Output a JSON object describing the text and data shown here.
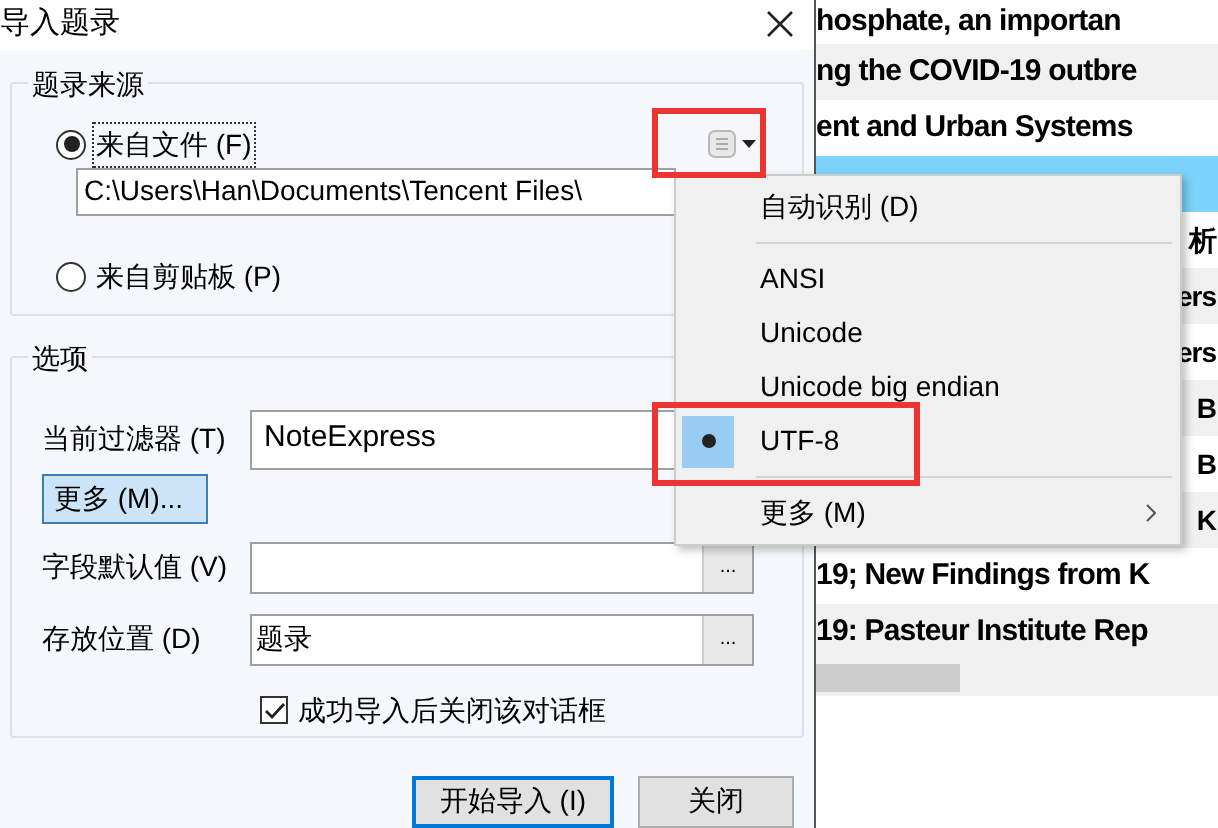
{
  "window": {
    "title": "导入题录"
  },
  "source_group": {
    "title": "题录来源",
    "options": [
      {
        "label": "来自文件 (F)",
        "selected": true,
        "path": "C:\\Users\\Han\\Documents\\Tencent Files\\"
      },
      {
        "label": "来自剪贴板 (P)",
        "selected": false
      }
    ]
  },
  "options_group": {
    "title": "选项",
    "filter": {
      "label": "当前过滤器 (T)",
      "value": "NoteExpress"
    },
    "more_button": "更多 (M)...",
    "default_value": {
      "label": "字段默认值 (V)",
      "button": "..."
    },
    "location": {
      "label": "存放位置 (D)",
      "value": "题录",
      "button": "..."
    },
    "close_after": {
      "label": "成功导入后关闭该对话框",
      "checked": true
    }
  },
  "buttons": [
    {
      "label": "开始导入 (I)",
      "default": true
    },
    {
      "label": "关闭",
      "default": false
    }
  ],
  "encoding_menu": [
    {
      "kind": "item",
      "label": "自动识别 (D)",
      "selected": false
    },
    {
      "kind": "separator"
    },
    {
      "kind": "item",
      "label": "ANSI",
      "selected": false
    },
    {
      "kind": "item",
      "label": "Unicode",
      "selected": false
    },
    {
      "kind": "item",
      "label": "Unicode big endian",
      "selected": false
    },
    {
      "kind": "item",
      "label": "UTF-8",
      "selected": true
    },
    {
      "kind": "separator"
    },
    {
      "kind": "submenu",
      "label": "更多 (M)"
    }
  ],
  "background_list": [
    {
      "kind": "full",
      "text": "hosphate, an importan",
      "selected": false
    },
    {
      "kind": "full",
      "text": "ng the COVID-19 outbre",
      "selected": false
    },
    {
      "kind": "full",
      "text": "ent and Urban Systems",
      "selected": false
    },
    {
      "kind": "covered",
      "selected": true
    },
    {
      "kind": "tail",
      "text": "析",
      "selected": false
    },
    {
      "kind": "tail",
      "text": "ers",
      "selected": false
    },
    {
      "kind": "tail",
      "text": "ers",
      "selected": false
    },
    {
      "kind": "tail",
      "text": "B",
      "selected": false
    },
    {
      "kind": "tail",
      "text": "B",
      "selected": false
    },
    {
      "kind": "tail",
      "text": "K",
      "selected": false
    },
    {
      "kind": "full",
      "text": "19; New Findings from K",
      "selected": false
    },
    {
      "kind": "full",
      "text": "19: Pasteur Institute Rep",
      "selected": false
    }
  ]
}
